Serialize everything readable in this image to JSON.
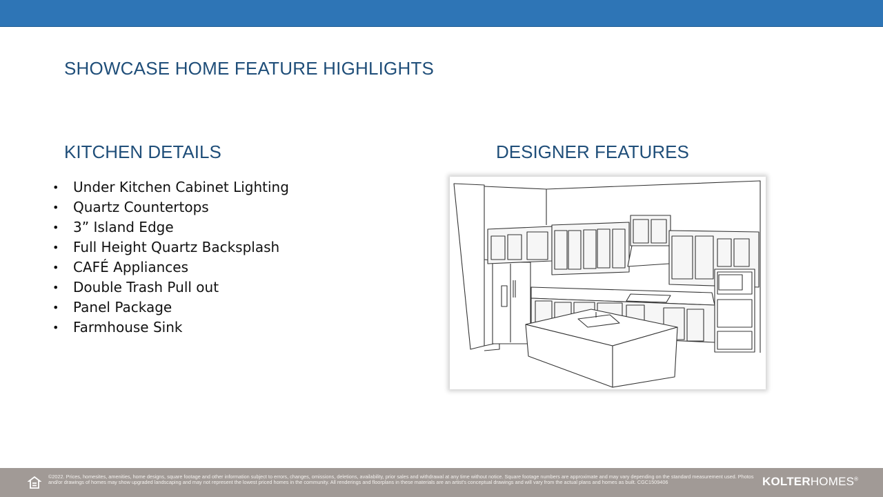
{
  "title": "SHOWCASE HOME FEATURE HIGHLIGHTS",
  "kitchen": {
    "heading": "KITCHEN DETAILS",
    "items": [
      "Under Kitchen Cabinet Lighting",
      "Quartz Countertops",
      "3” Island Edge",
      "Full Height Quartz Backsplash",
      "CAFÉ Appliances",
      "Double Trash Pull out",
      "Panel Package",
      "Farmhouse Sink"
    ]
  },
  "designer": {
    "heading": "DESIGNER FEATURES",
    "image": "kitchen-line-drawing"
  },
  "footer": {
    "legal": "©2022. Prices, homesites, amenities, home designs, square footage and other information subject to errors, changes, omissions, deletions, availability, prior sales and withdrawal at any time without notice. Square footage numbers are approximate and may vary depending on the standard measurement used. Photos and/or drawings of homes may show upgraded landscaping and may not represent the lowest priced homes in the community. All renderings and floorplans in these materials are an artist's conceptual drawings and will vary from the actual plans and homes as built. CGC1509406",
    "brand_bold": "KOLTER",
    "brand_light": "HOMES",
    "brand_mark": "®",
    "icon": "equal-housing-opportunity-icon"
  },
  "colors": {
    "top_bar": "#2e75b6",
    "heading": "#1f4e79",
    "footer": "#a19a96"
  }
}
